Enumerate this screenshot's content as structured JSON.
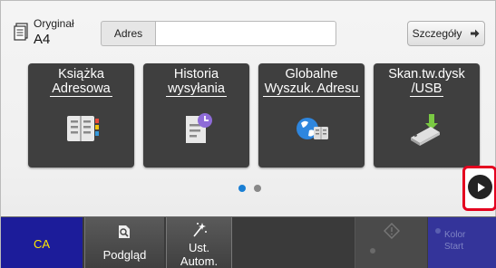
{
  "header": {
    "original_label": "Oryginał",
    "original_value": "A4",
    "address_label": "Adres",
    "address_value": "",
    "details_label": "Szczegóły"
  },
  "tiles": [
    {
      "label_line1": "Książka",
      "label_line2": "Adresowa",
      "icon": "address-book-icon"
    },
    {
      "label_line1": "Historia",
      "label_line2": "wysyłania",
      "icon": "send-history-icon"
    },
    {
      "label_line1": "Globalne",
      "label_line2": "Wyszuk. Adresu",
      "icon": "global-address-search-icon"
    },
    {
      "label_line1": "Skan.tw.dysk",
      "label_line2": "/USB",
      "icon": "usb-scan-icon"
    }
  ],
  "pagination": {
    "pages": 2,
    "current": 1
  },
  "footer": {
    "ca_label": "CA",
    "preview_label": "Podgląd",
    "auto_label_line1": "Ust.",
    "auto_label_line2": "Autom.",
    "color_start_line1": "Kolor",
    "color_start_line2": "Start"
  },
  "colors": {
    "tile_bg": "#3f3f3f",
    "active_dot": "#1a7fd4",
    "inactive_dot": "#888888",
    "highlight": "#e4001f",
    "ca_bg": "#1c1c9a",
    "ca_text": "#ffe800",
    "color_start_bg": "#34349a"
  }
}
